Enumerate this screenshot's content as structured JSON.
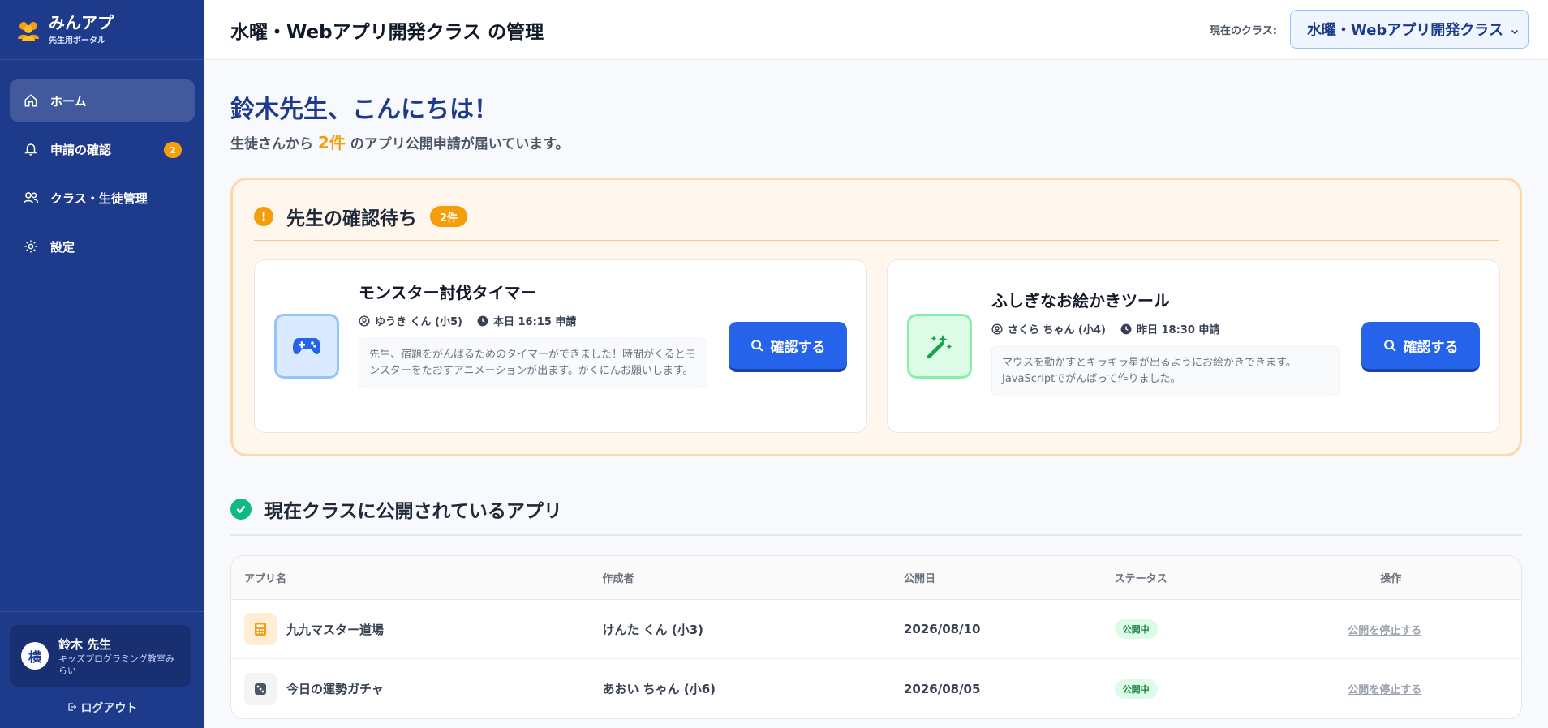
{
  "brand": {
    "name": "みんアプ",
    "subtitle": "先生用ポータル"
  },
  "sidebar": {
    "items": [
      {
        "label": "ホーム",
        "icon": "home-icon",
        "active": true
      },
      {
        "label": "申請の確認",
        "icon": "bell-icon",
        "badge": "2"
      },
      {
        "label": "クラス・生徒管理",
        "icon": "users-icon"
      },
      {
        "label": "設定",
        "icon": "gear-icon"
      }
    ],
    "user": {
      "avatar": "横",
      "name": "鈴木 先生",
      "org": "キッズプログラミング教室みらい"
    },
    "logout": "ログアウト"
  },
  "header": {
    "title": "水曜・Webアプリ開発クラス の管理",
    "class_label": "現在のクラス:",
    "class_selected": "水曜・Webアプリ開発クラス"
  },
  "greeting": {
    "title": "鈴木先生、こんにちは！",
    "sub_prefix": "生徒さんから ",
    "sub_count": "2件",
    "sub_suffix": " のアプリ公開申請が届いています。"
  },
  "pending": {
    "title": "先生の確認待ち",
    "badge": "2件",
    "cards": [
      {
        "title": "モンスター討伐タイマー",
        "author": "ゆうき くん (小5)",
        "time": "本日 16:15 申請",
        "desc": "先生、宿題をがんばるためのタイマーができました！時間がくるとモンスターをたおすアニメーションが出ます。かくにんお願いします。",
        "button": "確認する",
        "icon": "gamepad-icon"
      },
      {
        "title": "ふしぎなお絵かきツール",
        "author": "さくら ちゃん (小4)",
        "time": "昨日 18:30 申請",
        "desc": "マウスを動かすとキラキラ星が出るようにお絵かきできます。JavaScriptでがんばって作りました。",
        "button": "確認する",
        "icon": "magic-wand-icon"
      }
    ]
  },
  "published": {
    "title": "現在クラスに公開されているアプリ",
    "columns": [
      "アプリ名",
      "作成者",
      "公開日",
      "ステータス",
      "操作"
    ],
    "rows": [
      {
        "name": "九九マスター道場",
        "author": "けんた くん (小3)",
        "date": "2026/08/10",
        "status": "公開中",
        "action": "公開を停止する",
        "icon": "calculator-icon"
      },
      {
        "name": "今日の運勢ガチャ",
        "author": "あおい ちゃん (小6)",
        "date": "2026/08/05",
        "status": "公開中",
        "action": "公開を停止する",
        "icon": "dice-icon"
      }
    ]
  },
  "colors": {
    "sidebar": "#1e3a8a",
    "accent": "#2563eb",
    "warning": "#f59e0b",
    "success": "#10b981"
  }
}
